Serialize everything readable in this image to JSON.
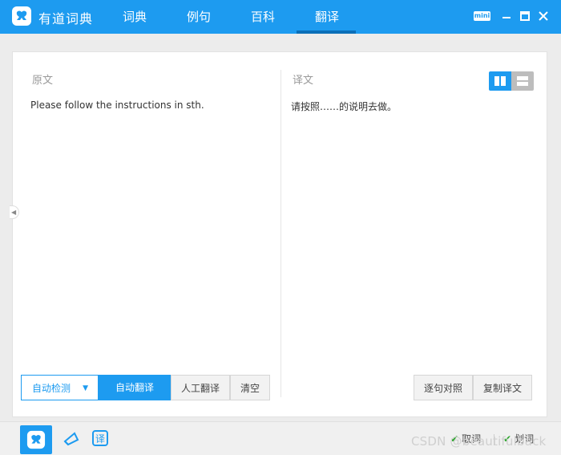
{
  "app": {
    "name": "有道词典"
  },
  "tabs": [
    {
      "label": "词典"
    },
    {
      "label": "例句"
    },
    {
      "label": "百科"
    },
    {
      "label": "翻译",
      "active": true
    }
  ],
  "window": {
    "mini_label": "mini"
  },
  "source": {
    "title": "原文",
    "text": "Please follow the instructions in sth."
  },
  "target": {
    "title": "译文",
    "text": "请按照……的说明去做。"
  },
  "buttons": {
    "auto_detect": "自动检测",
    "auto_translate": "自动翻译",
    "human_translate": "人工翻译",
    "clear": "清空",
    "sentence_compare": "逐句对照",
    "copy_translation": "复制译文"
  },
  "bottombar": {
    "take_word": "取词",
    "select_word": "划词"
  },
  "watermark": "CSDN @beautifulback",
  "colors": {
    "accent": "#1d9bf0",
    "check": "#2aa52a"
  }
}
